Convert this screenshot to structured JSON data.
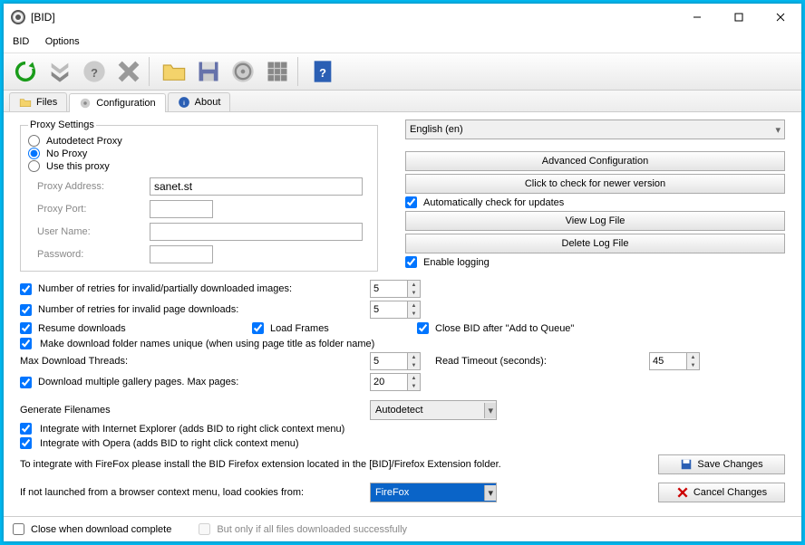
{
  "title": "[BID]",
  "menu": {
    "bid": "BID",
    "options": "Options"
  },
  "tabs": {
    "files": "Files",
    "configuration": "Configuration",
    "about": "About"
  },
  "proxy": {
    "legend": "Proxy Settings",
    "autodetect": "Autodetect Proxy",
    "noproxy": "No Proxy",
    "usethis": "Use this proxy",
    "addr_label": "Proxy Address:",
    "addr_value": "sanet.st",
    "port_label": "Proxy Port:",
    "port_value": "",
    "user_label": "User Name:",
    "user_value": "",
    "pass_label": "Password:",
    "pass_value": ""
  },
  "right": {
    "language": "English (en)",
    "adv": "Advanced Configuration",
    "check_ver": "Click to check for newer version",
    "auto_update": "Automatically check for updates",
    "view_log": "View Log File",
    "delete_log": "Delete Log File",
    "enable_log": "Enable logging"
  },
  "opts": {
    "retries_img": "Number of retries for invalid/partially downloaded images:",
    "retries_img_v": "5",
    "retries_page": "Number of retries for invalid page downloads:",
    "retries_page_v": "5",
    "resume": "Resume downloads",
    "load_frames": "Load Frames",
    "close_after": "Close BID after \"Add to Queue\"",
    "unique_folder": "Make download folder names unique (when using page title as folder name)",
    "max_threads": "Max Download Threads:",
    "max_threads_v": "5",
    "read_timeout": "Read Timeout (seconds):",
    "read_timeout_v": "45",
    "multi_gallery": "Download multiple gallery pages. Max pages:",
    "multi_gallery_v": "20",
    "gen_filenames": "Generate Filenames",
    "gen_filenames_v": "Autodetect",
    "integ_ie": "Integrate with Internet Explorer (adds BID to right click context menu)",
    "integ_opera": "Integrate with Opera (adds BID to right click context menu)",
    "firefox_note": "To integrate with FireFox please install the BID Firefox extension located in the [BID]/Firefox Extension folder.",
    "cookies_label": "If not launched from a browser context menu, load cookies from:",
    "cookies_value": "FireFox"
  },
  "buttons": {
    "save": "Save Changes",
    "cancel": "Cancel Changes"
  },
  "status": {
    "close_when": "Close when download complete",
    "only_if": "But only if all files downloaded successfully"
  }
}
